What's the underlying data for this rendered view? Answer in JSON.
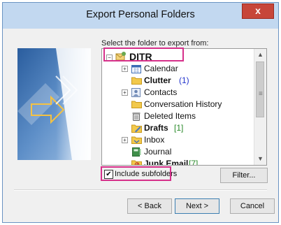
{
  "window": {
    "title": "Export Personal Folders",
    "close_glyph": "x"
  },
  "prompt": "Select the folder to export from:",
  "tree": {
    "items": [
      {
        "label": "DITR",
        "icon": "mailbox-icon",
        "expander": "−",
        "count": ""
      },
      {
        "label": "Calendar",
        "icon": "calendar-icon",
        "expander": "+",
        "count": ""
      },
      {
        "label": "Clutter",
        "icon": "folder-icon",
        "expander": "",
        "count": "(1)"
      },
      {
        "label": "Contacts",
        "icon": "contacts-icon",
        "expander": "+",
        "count": ""
      },
      {
        "label": "Conversation History",
        "icon": "folder-icon",
        "expander": "",
        "count": ""
      },
      {
        "label": "Deleted Items",
        "icon": "trash-icon",
        "expander": "",
        "count": ""
      },
      {
        "label": "Drafts",
        "icon": "drafts-icon",
        "expander": "",
        "count": "[1]"
      },
      {
        "label": "Inbox",
        "icon": "inbox-icon",
        "expander": "+",
        "count": ""
      },
      {
        "label": "Journal",
        "icon": "journal-icon",
        "expander": "",
        "count": ""
      },
      {
        "label": "Junk Email",
        "icon": "junk-icon",
        "expander": "",
        "count": "[7]"
      }
    ]
  },
  "include_subfolders": {
    "label": "Include subfolders",
    "checked": true
  },
  "buttons": {
    "filter": "Filter...",
    "back": "< Back",
    "next": "Next >",
    "cancel": "Cancel"
  },
  "scrollbar": {
    "up": "▲",
    "down": "▼",
    "grip": "≡"
  },
  "colors": {
    "highlight": "#d6308a",
    "count_blue": "#2233cc",
    "count_green": "#2a8a2a",
    "titlebar": "#c2d8f0",
    "close": "#c7463a"
  }
}
